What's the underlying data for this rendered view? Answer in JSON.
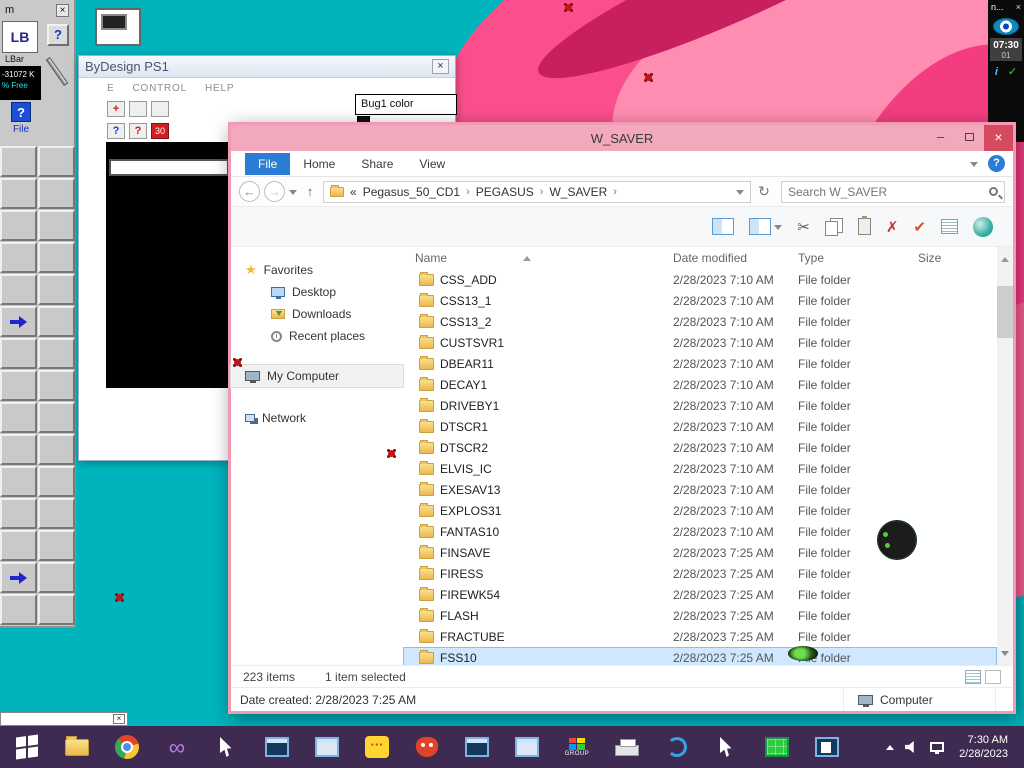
{
  "left_toolbar": {
    "title": "m",
    "lb_icon": "LB",
    "lbar_label": "LBar",
    "free_line1": "-31072 K",
    "free_line2": "% Free",
    "file_button_label": "File",
    "arrow_cells": [
      10,
      26
    ],
    "grid_cells": 30
  },
  "bydesign": {
    "title": "ByDesign PS1",
    "menu": {
      "item1": "E",
      "item2": "CONTROL",
      "item3": "HELP"
    },
    "badge_30": "30",
    "popup_label": "Bug1 color"
  },
  "explorer": {
    "title": "W_SAVER",
    "tabs": {
      "file": "File",
      "home": "Home",
      "share": "Share",
      "view": "View"
    },
    "breadcrumb": {
      "prefix": "«",
      "separator": "›",
      "items": [
        "Pegasus_50_CD1",
        "PEGASUS",
        "W_SAVER"
      ]
    },
    "search_placeholder": "Search W_SAVER",
    "sidebar": {
      "favorites": "Favorites",
      "fav_items": [
        "Desktop",
        "Downloads",
        "Recent places"
      ],
      "computer": "My Computer",
      "network": "Network"
    },
    "columns": {
      "name": "Name",
      "date": "Date modified",
      "type": "Type",
      "size": "Size"
    },
    "rows": [
      {
        "name": "CSS_ADD",
        "date": "2/28/2023 7:10 AM",
        "type": "File folder",
        "size": ""
      },
      {
        "name": "CSS13_1",
        "date": "2/28/2023 7:10 AM",
        "type": "File folder",
        "size": ""
      },
      {
        "name": "CSS13_2",
        "date": "2/28/2023 7:10 AM",
        "type": "File folder",
        "size": ""
      },
      {
        "name": "CUSTSVR1",
        "date": "2/28/2023 7:10 AM",
        "type": "File folder",
        "size": ""
      },
      {
        "name": "DBEAR11",
        "date": "2/28/2023 7:10 AM",
        "type": "File folder",
        "size": ""
      },
      {
        "name": "DECAY1",
        "date": "2/28/2023 7:10 AM",
        "type": "File folder",
        "size": ""
      },
      {
        "name": "DRIVEBY1",
        "date": "2/28/2023 7:10 AM",
        "type": "File folder",
        "size": ""
      },
      {
        "name": "DTSCR1",
        "date": "2/28/2023 7:10 AM",
        "type": "File folder",
        "size": ""
      },
      {
        "name": "DTSCR2",
        "date": "2/28/2023 7:10 AM",
        "type": "File folder",
        "size": ""
      },
      {
        "name": "ELVIS_IC",
        "date": "2/28/2023 7:10 AM",
        "type": "File folder",
        "size": ""
      },
      {
        "name": "EXESAV13",
        "date": "2/28/2023 7:10 AM",
        "type": "File folder",
        "size": ""
      },
      {
        "name": "EXPLOS31",
        "date": "2/28/2023 7:10 AM",
        "type": "File folder",
        "size": ""
      },
      {
        "name": "FANTAS10",
        "date": "2/28/2023 7:10 AM",
        "type": "File folder",
        "size": ""
      },
      {
        "name": "FINSAVE",
        "date": "2/28/2023 7:25 AM",
        "type": "File folder",
        "size": ""
      },
      {
        "name": "FIRESS",
        "date": "2/28/2023 7:25 AM",
        "type": "File folder",
        "size": ""
      },
      {
        "name": "FIREWK54",
        "date": "2/28/2023 7:25 AM",
        "type": "File folder",
        "size": ""
      },
      {
        "name": "FLASH",
        "date": "2/28/2023 7:25 AM",
        "type": "File folder",
        "size": ""
      },
      {
        "name": "FRACTUBE",
        "date": "2/28/2023 7:25 AM",
        "type": "File folder",
        "size": ""
      },
      {
        "name": "FSS10",
        "date": "2/28/2023 7:25 AM",
        "type": "File folder",
        "size": ""
      }
    ],
    "selected_index": 18,
    "status": {
      "items": "223 items",
      "selected": "1 item selected"
    },
    "details": {
      "text": "Date created: 2/28/2023 7:25 AM",
      "location": "Computer"
    }
  },
  "gadget": {
    "title": "n...",
    "time": "07:30",
    "counter": "01",
    "info": "i",
    "check": "✓"
  },
  "taskbar": {
    "group_label": "GROUP",
    "clock_time": "7:30 AM",
    "clock_date": "2/28/2023"
  }
}
